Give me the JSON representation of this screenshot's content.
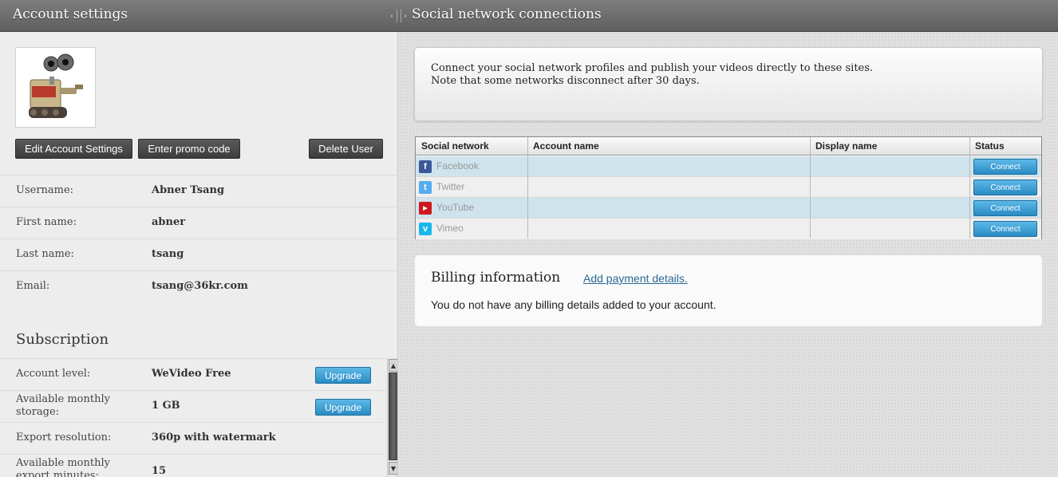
{
  "header": {
    "left_title": "Account settings",
    "right_title": "Social network connections"
  },
  "account": {
    "buttons": {
      "edit": "Edit Account Settings",
      "promo": "Enter promo code",
      "delete": "Delete User"
    },
    "fields": [
      {
        "label": "Username:",
        "value": "Abner Tsang"
      },
      {
        "label": "First name:",
        "value": "abner"
      },
      {
        "label": "Last name:",
        "value": "tsang"
      },
      {
        "label": "Email:",
        "value": "tsang@36kr.com"
      }
    ]
  },
  "subscription": {
    "title": "Subscription",
    "rows": [
      {
        "label": "Account level:",
        "value": "WeVideo Free",
        "button": "Upgrade"
      },
      {
        "label": "Available monthly storage:",
        "value": "1 GB",
        "button": "Upgrade"
      },
      {
        "label": "Export resolution:",
        "value": "360p with watermark"
      },
      {
        "label": "Available monthly export minutes:",
        "value": "15"
      }
    ]
  },
  "social": {
    "intro_line1": "Connect your social network profiles and publish your videos directly to these sites.",
    "intro_line2": "Note that some networks disconnect after 30 days.",
    "columns": [
      "Social network",
      "Account name",
      "Display name",
      "Status"
    ],
    "rows": [
      {
        "network": "Facebook",
        "icon": "facebook-icon",
        "account": "",
        "display": "",
        "action": "Connect",
        "color": "#3b5998"
      },
      {
        "network": "Twitter",
        "icon": "twitter-icon",
        "account": "",
        "display": "",
        "action": "Connect",
        "color": "#55acee"
      },
      {
        "network": "YouTube",
        "icon": "youtube-icon",
        "account": "",
        "display": "",
        "action": "Connect",
        "color": "#cc181e"
      },
      {
        "network": "Vimeo",
        "icon": "vimeo-icon",
        "account": "",
        "display": "",
        "action": "Connect",
        "color": "#1ab7ea"
      }
    ]
  },
  "billing": {
    "title": "Billing information",
    "link": "Add payment details.",
    "description": "You do not have any billing details added to your account."
  }
}
